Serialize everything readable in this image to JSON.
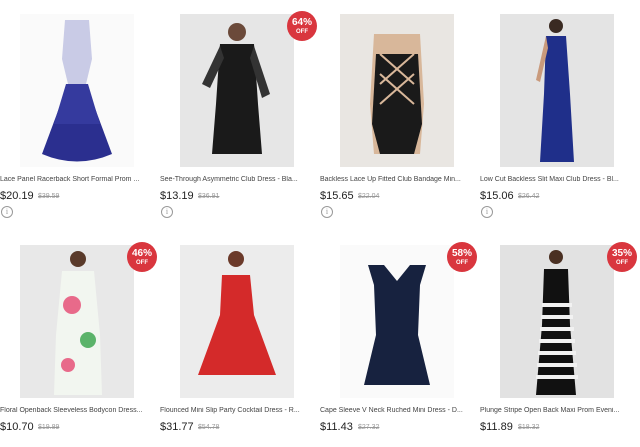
{
  "products": [
    {
      "title": "Lace Panel Racerback Short Formal Prom ...",
      "price": "$20.19",
      "original_price": "$39.59",
      "discount": "",
      "discount_suffix": "",
      "color": "#2b2f8f"
    },
    {
      "title": "See-Through Asymmetric Club Dress - Bla...",
      "price": "$13.19",
      "original_price": "$36.91",
      "discount": "64%",
      "discount_suffix": "OFF",
      "color": "#1a1a1a"
    },
    {
      "title": "Backless Lace Up Fitted Club Bandage Min...",
      "price": "$15.65",
      "original_price": "$22.04",
      "discount": "",
      "discount_suffix": "",
      "color": "#1a1a1a"
    },
    {
      "title": "Low Cut Backless Slit Maxi Club Dress - Bl...",
      "price": "$15.06",
      "original_price": "$26.42",
      "discount": "",
      "discount_suffix": "",
      "color": "#1f2f8a"
    },
    {
      "title": "Floral Openback Sleeveless Bodycon Dress...",
      "price": "$10.70",
      "original_price": "$19.89",
      "discount": "46%",
      "discount_suffix": "OFF",
      "color": "#e8f0e4"
    },
    {
      "title": "Flounced Mini Slip Party Cocktail Dress - R...",
      "price": "$31.77",
      "original_price": "$54.78",
      "discount": "",
      "discount_suffix": "",
      "color": "#d42a2a"
    },
    {
      "title": "Cape Sleeve V Neck Ruched Mini Dress - D...",
      "price": "$11.43",
      "original_price": "$27.32",
      "discount": "58%",
      "discount_suffix": "OFF",
      "color": "#17223f"
    },
    {
      "title": "Plunge Stripe Open Back Maxi Prom Eveni...",
      "price": "$11.89",
      "original_price": "$18.32",
      "discount": "35%",
      "discount_suffix": "OFF",
      "color": "#111111"
    }
  ],
  "info_icon": "info-circle-icon"
}
